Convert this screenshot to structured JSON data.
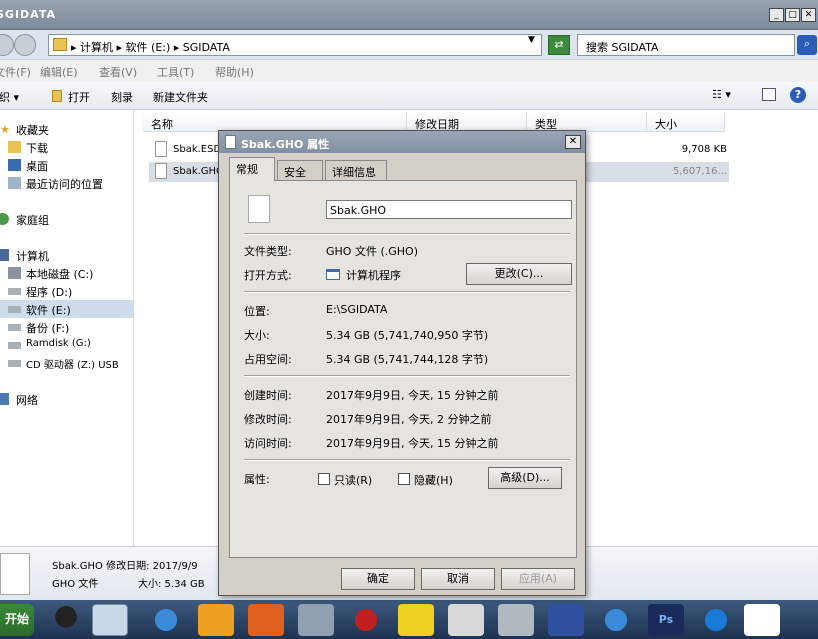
{
  "window": {
    "title": "SGIDATA"
  },
  "address": {
    "crumbs": "▸ 计算机 ▸ 软件 (E:) ▸ SGIDATA",
    "search_placeholder": "搜索 SGIDATA"
  },
  "menu": [
    "文件(F)",
    "编辑(E)",
    "查看(V)",
    "工具(T)",
    "帮助(H)"
  ],
  "toolbar": {
    "organize": "组织 ▾",
    "open": "打开",
    "burn": "刻录",
    "new_folder": "新建文件夹"
  },
  "nav": {
    "favorites": "收藏夹",
    "downloads": "下载",
    "desktop": "桌面",
    "recent": "最近访问的位置",
    "homegroup": "家庭组",
    "computer": "计算机",
    "drive_c": "本地磁盘 (C:)",
    "drive_d": "程序 (D:)",
    "drive_e": "软件 (E:)",
    "drive_f": "备份 (F:)",
    "drive_g": "Ramdisk (G:)",
    "drive_z": "CD 驱动器 (Z:) USB",
    "network": "网络"
  },
  "columns": {
    "name": "名称",
    "modified": "修改日期",
    "type": "类型",
    "size": "大小"
  },
  "files": [
    {
      "name": "Sbak.ESD",
      "size": "9,708 KB"
    },
    {
      "name": "Sbak.GHO",
      "size": "5,607,16..."
    }
  ],
  "details": {
    "line1": "Sbak.GHO  修改日期: 2017/9/9",
    "line2_type": "GHO 文件",
    "line2_size": "大小: 5.34 GB"
  },
  "dialog": {
    "title": "Sbak.GHO 属性",
    "tabs": [
      "常规",
      "安全",
      "详细信息"
    ],
    "filename": "Sbak.GHO",
    "type_label": "文件类型:",
    "type_value": "GHO 文件 (.GHO)",
    "open_label": "打开方式:",
    "open_value": "计算机程序",
    "change_btn": "更改(C)...",
    "location_label": "位置:",
    "location_value": "E:\\SGIDATA",
    "size_label": "大小:",
    "size_value": "5.34 GB (5,741,740,950 字节)",
    "disk_label": "占用空间:",
    "disk_value": "5.34 GB (5,741,744,128 字节)",
    "created_label": "创建时间:",
    "created_value": "2017年9月9日, 今天, 15 分钟之前",
    "modified_label": "修改时间:",
    "modified_value": "2017年9月9日, 今天, 2 分钟之前",
    "accessed_label": "访问时间:",
    "accessed_value": "2017年9月9日, 今天, 15 分钟之前",
    "attr_label": "属性:",
    "readonly": "只读(R)",
    "hidden": "隐藏(H)",
    "advanced_btn": "高级(D)...",
    "ok_btn": "确定",
    "cancel_btn": "取消",
    "apply_btn": "应用(A)"
  },
  "taskbar": {
    "start": "开始"
  }
}
